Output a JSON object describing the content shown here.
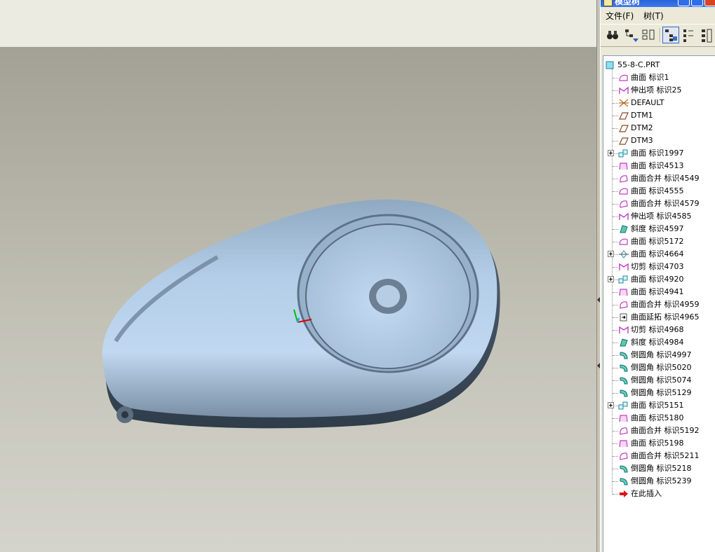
{
  "window": {
    "title": "模型树"
  },
  "menu": {
    "file": "文件(F)",
    "tree": "树(T)"
  },
  "toolbar": [
    {
      "name": "find-binoculars-icon"
    },
    {
      "name": "tree-filter-icon"
    },
    {
      "name": "settings-columns-icon"
    },
    {
      "name": "show-tree-icon",
      "active": true
    },
    {
      "name": "layer-tree-icon"
    },
    {
      "name": "column-display-icon"
    }
  ],
  "tree": {
    "root": "55-8-C.PRT",
    "items": [
      {
        "label": "曲面 标识1",
        "icon": "surface-icon",
        "expandable": false
      },
      {
        "label": "伸出项 标识25",
        "icon": "protrusion-icon",
        "expandable": false
      },
      {
        "label": "DEFAULT",
        "icon": "coordinate-system-icon",
        "expandable": false
      },
      {
        "label": "DTM1",
        "icon": "datum-plane-icon",
        "expandable": false
      },
      {
        "label": "DTM2",
        "icon": "datum-plane-icon",
        "expandable": false
      },
      {
        "label": "DTM3",
        "icon": "datum-plane-icon",
        "expandable": false
      },
      {
        "label": "曲面 标识1997",
        "icon": "copy-surface-icon",
        "expandable": true
      },
      {
        "label": "曲面 标识4513",
        "icon": "boundary-surface-icon",
        "expandable": false
      },
      {
        "label": "曲面合并 标识4549",
        "icon": "merge-icon",
        "expandable": false
      },
      {
        "label": "曲面 标识4555",
        "icon": "surface-icon",
        "expandable": false
      },
      {
        "label": "曲面合并 标识4579",
        "icon": "merge-icon",
        "expandable": false
      },
      {
        "label": "伸出项 标识4585",
        "icon": "protrusion-icon",
        "expandable": false
      },
      {
        "label": "斜度 标识4597",
        "icon": "draft-icon",
        "expandable": false
      },
      {
        "label": "曲面 标识5172",
        "icon": "surface-icon",
        "expandable": false
      },
      {
        "label": "曲面 标识4664",
        "icon": "sweep-surface-icon",
        "expandable": true
      },
      {
        "label": "切剪 标识4703",
        "icon": "cut-icon",
        "expandable": false
      },
      {
        "label": "曲面 标识4920",
        "icon": "copy-surface-icon",
        "expandable": true
      },
      {
        "label": "曲面 标识4941",
        "icon": "boundary-surface-icon",
        "expandable": false
      },
      {
        "label": "曲面合并 标识4959",
        "icon": "merge-icon",
        "expandable": false
      },
      {
        "label": "曲面延拓 标识4965",
        "icon": "extend-icon",
        "expandable": false
      },
      {
        "label": "切剪 标识4968",
        "icon": "cut-icon",
        "expandable": false
      },
      {
        "label": "斜度 标识4984",
        "icon": "draft-icon",
        "expandable": false
      },
      {
        "label": "倒圆角 标识4997",
        "icon": "round-icon",
        "expandable": false
      },
      {
        "label": "倒圆角 标识5020",
        "icon": "round-icon",
        "expandable": false
      },
      {
        "label": "倒圆角 标识5074",
        "icon": "round-icon",
        "expandable": false
      },
      {
        "label": "倒圆角 标识5129",
        "icon": "round-icon",
        "expandable": false
      },
      {
        "label": "曲面 标识5151",
        "icon": "copy-surface-icon",
        "expandable": true
      },
      {
        "label": "曲面 标识5180",
        "icon": "boundary-surface-icon",
        "expandable": false
      },
      {
        "label": "曲面合并 标识5192",
        "icon": "merge-icon",
        "expandable": false
      },
      {
        "label": "曲面 标识5198",
        "icon": "boundary-surface-icon",
        "expandable": false
      },
      {
        "label": "曲面合并 标识5211",
        "icon": "merge-icon",
        "expandable": false
      },
      {
        "label": "倒圆角 标识5218",
        "icon": "round-icon",
        "expandable": false
      },
      {
        "label": "倒圆角 标识5239",
        "icon": "round-icon",
        "expandable": false
      },
      {
        "label": "在此插入",
        "icon": "insert-here-arrow-icon",
        "expandable": false
      }
    ]
  },
  "colors": {
    "viewport_top": "#a3a195",
    "viewport_bottom": "#d5d4cc",
    "model_body": "#a9c4e0",
    "titlebar": "#2a63d8"
  }
}
